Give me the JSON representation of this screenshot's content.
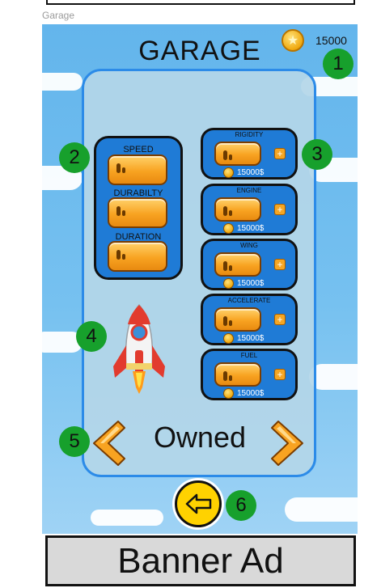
{
  "frame_label": "Garage",
  "title": "GARAGE",
  "coins": "15000",
  "stats": [
    "SPEED",
    "DURABILTY",
    "DURATION"
  ],
  "upgrades": [
    {
      "title": "RIGIDITY",
      "price": "15000$"
    },
    {
      "title": "ENGINE",
      "price": "15000$"
    },
    {
      "title": "WING",
      "price": "15000$"
    },
    {
      "title": "ACCELERATE",
      "price": "15000$"
    },
    {
      "title": "FUEL",
      "price": "15000$"
    }
  ],
  "status": "Owned",
  "badges": [
    "1",
    "2",
    "3",
    "4",
    "5",
    "6"
  ],
  "banner": "Banner Ad",
  "icons": {
    "coin": "coin-icon",
    "plus": "plus-icon",
    "rocket": "rocket-icon",
    "prev": "chevron-left-icon",
    "next": "chevron-right-icon",
    "back": "back-arrow-icon"
  },
  "colors": {
    "sky": "#76c1f0",
    "panel_border": "#2c8be8",
    "card": "#1f7bd6",
    "badge": "#17a02c",
    "gold": "#f8a321"
  }
}
